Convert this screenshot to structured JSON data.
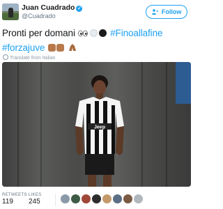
{
  "user": {
    "name": "Juan Cuadrado",
    "handle": "@Cuadrado",
    "verified_glyph": "✓",
    "avatar_icon": "profile-photo"
  },
  "follow_button": {
    "label": "Follow",
    "icon": "add-user-icon"
  },
  "tweet": {
    "text_before": "Pronti per domani ",
    "hashtag1": "#Finoallafine",
    "hashtag2": "#forzajuve"
  },
  "translate": {
    "label": "Translate from Italian"
  },
  "stats": {
    "retweets_label": "RETWEETS",
    "retweets_value": "119",
    "likes_label": "LIKES",
    "likes_value": "245"
  },
  "colors": {
    "accent": "#1da1f2",
    "text": "#14171a",
    "muted": "#657786"
  }
}
